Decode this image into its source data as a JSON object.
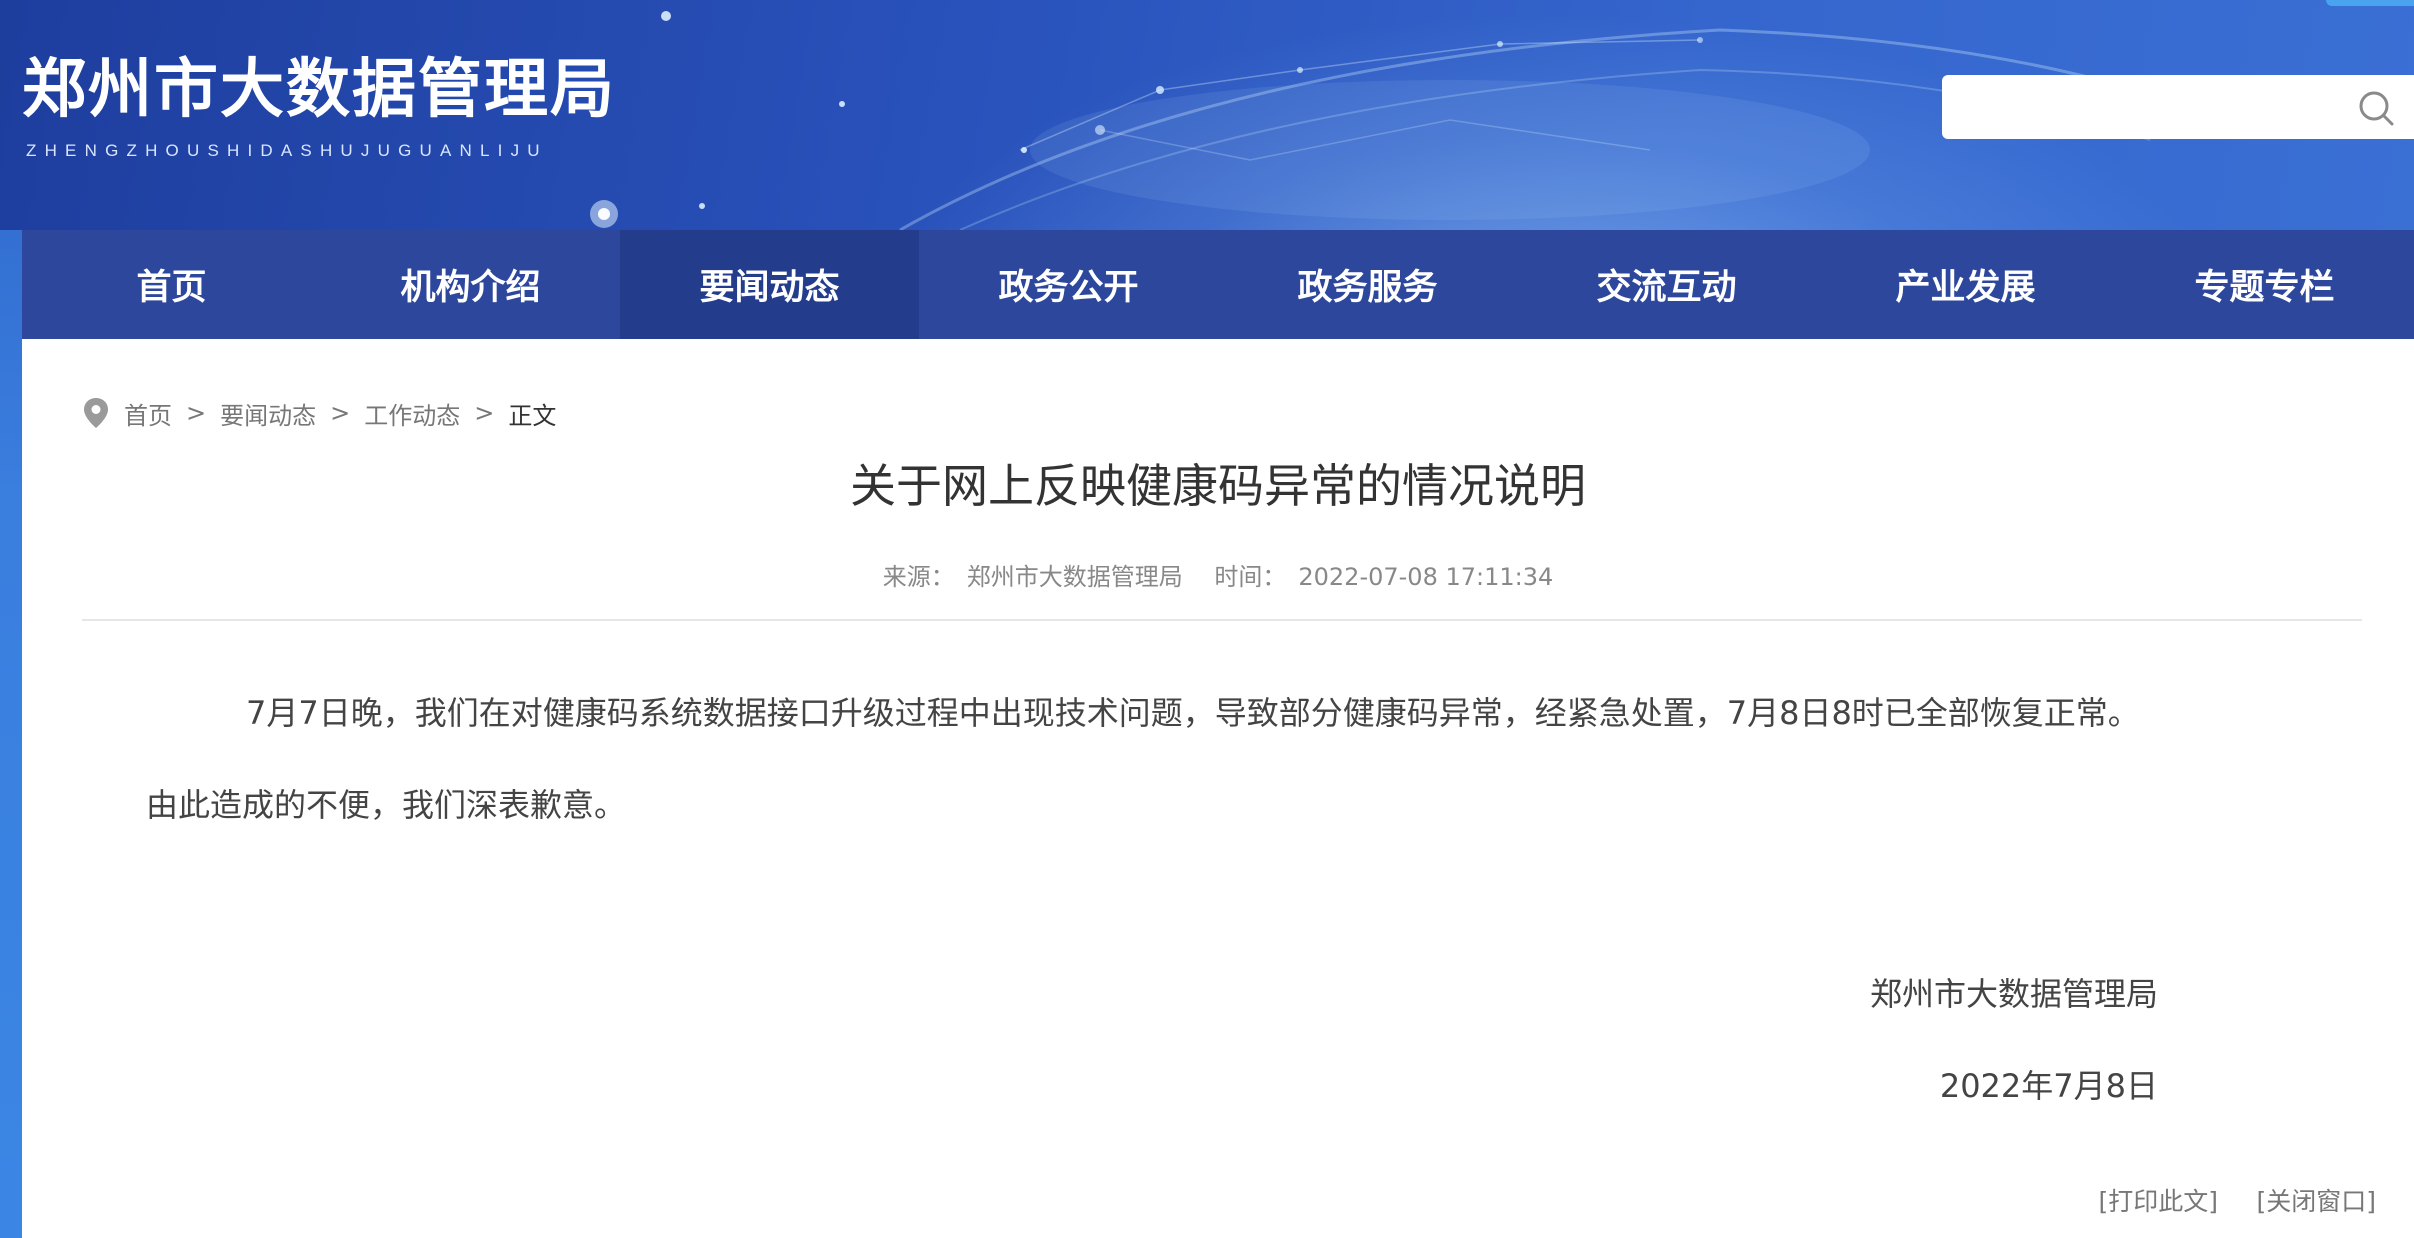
{
  "header": {
    "logo_cn": "郑州市大数据管理局",
    "logo_en": "ZHENGZHOUSHIDASHUJUGUANLIJU",
    "search": {
      "value": "",
      "placeholder": ""
    }
  },
  "nav": {
    "items": [
      {
        "label": "首页"
      },
      {
        "label": "机构介绍"
      },
      {
        "label": "要闻动态",
        "active": true
      },
      {
        "label": "政务公开"
      },
      {
        "label": "政务服务"
      },
      {
        "label": "交流互动"
      },
      {
        "label": "产业发展"
      },
      {
        "label": "专题专栏"
      }
    ]
  },
  "breadcrumb": {
    "items": [
      "首页",
      "要闻动态",
      "工作动态"
    ],
    "separator": ">",
    "current": "正文"
  },
  "article": {
    "title": "关于网上反映健康码异常的情况说明",
    "source_label": "来源：",
    "source": "郑州市大数据管理局",
    "time_label": "时间：",
    "time": "2022-07-08 17:11:34",
    "paragraphs": [
      "7月7日晚，我们在对健康码系统数据接口升级过程中出现技术问题，导致部分健康码异常，经紧急处置，7月8日8时已全部恢复正常。",
      "由此造成的不便，我们深表歉意。"
    ],
    "signature_org": "郑州市大数据管理局",
    "signature_date": "2022年7月8日"
  },
  "actions": {
    "print": "[打印此文]",
    "close": "[关闭窗口]"
  },
  "colors": {
    "nav_bg": "#2d479c",
    "nav_active_bg": "#233c8c",
    "header_bg": "#2952bb",
    "text": "#333333",
    "muted": "#888888"
  },
  "icons": {
    "search": "search-icon",
    "location": "location-pin-icon"
  }
}
